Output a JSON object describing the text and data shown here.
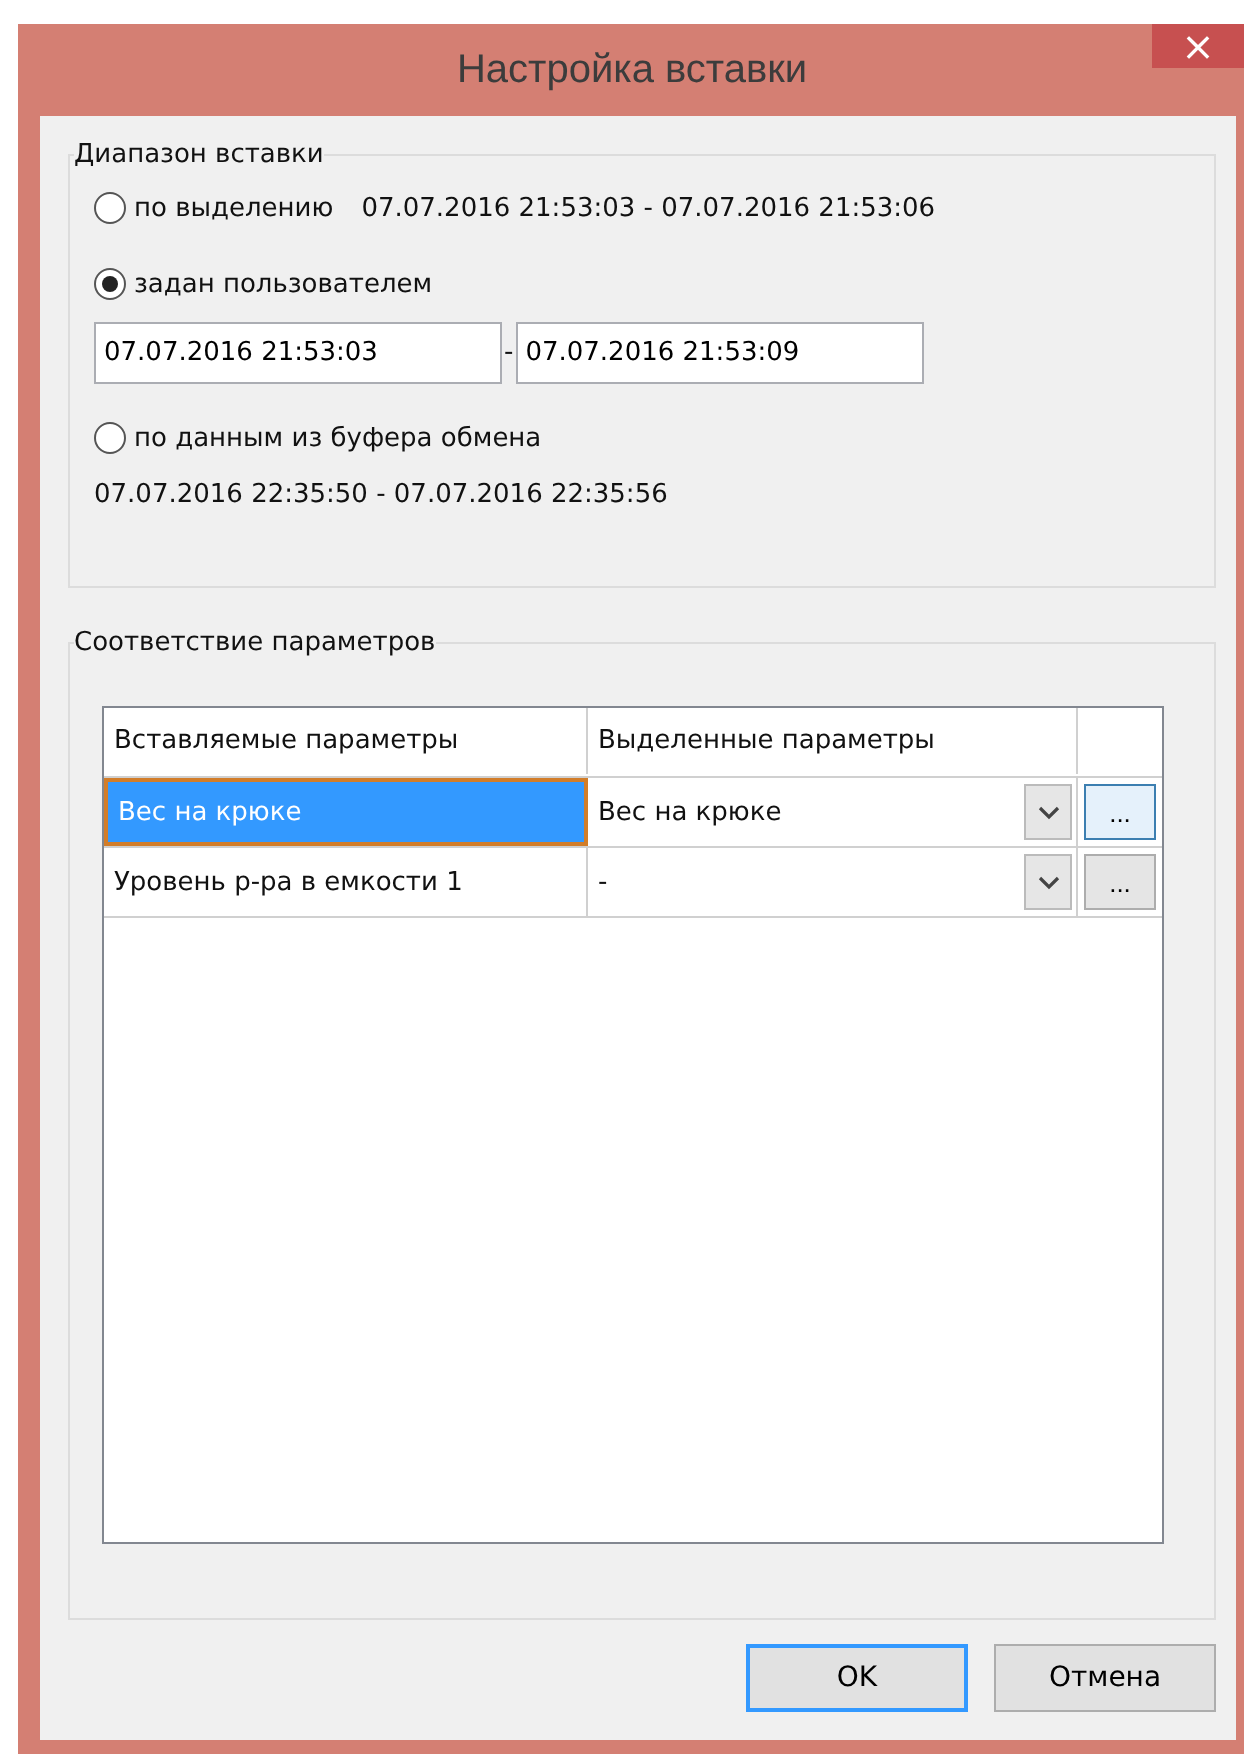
{
  "window": {
    "title": "Настройка вставки",
    "close": "×"
  },
  "range_group": {
    "legend": "Диапазон вставки",
    "options": [
      {
        "kind": "inline",
        "label": "по выделению",
        "selected": false,
        "range": "07.07.2016 21:53:03 - 07.07.2016 21:53:06"
      },
      {
        "kind": "fields",
        "label": "задан пользователем",
        "selected": true,
        "from": "07.07.2016 21:53:03",
        "separator": "-",
        "to": "07.07.2016 21:53:09"
      },
      {
        "kind": "below",
        "label": "по данным из буфера обмена",
        "selected": false,
        "range": "07.07.2016 22:35:50 - 07.07.2016 22:35:56"
      }
    ]
  },
  "mapping_group": {
    "legend": "Соответствие параметров",
    "columns": [
      "Вставляемые параметры",
      "Выделенные параметры"
    ],
    "rows": [
      {
        "inserted": "Вес на крюке",
        "mapped": "Вес на крюке",
        "browse": "...",
        "selected": true
      },
      {
        "inserted": "Уровень р-ра в емкости 1",
        "mapped": "-",
        "browse": "...",
        "selected": false
      }
    ]
  },
  "buttons": [
    {
      "label": "OK",
      "default": true
    },
    {
      "label": "Отмена",
      "default": false
    }
  ]
}
